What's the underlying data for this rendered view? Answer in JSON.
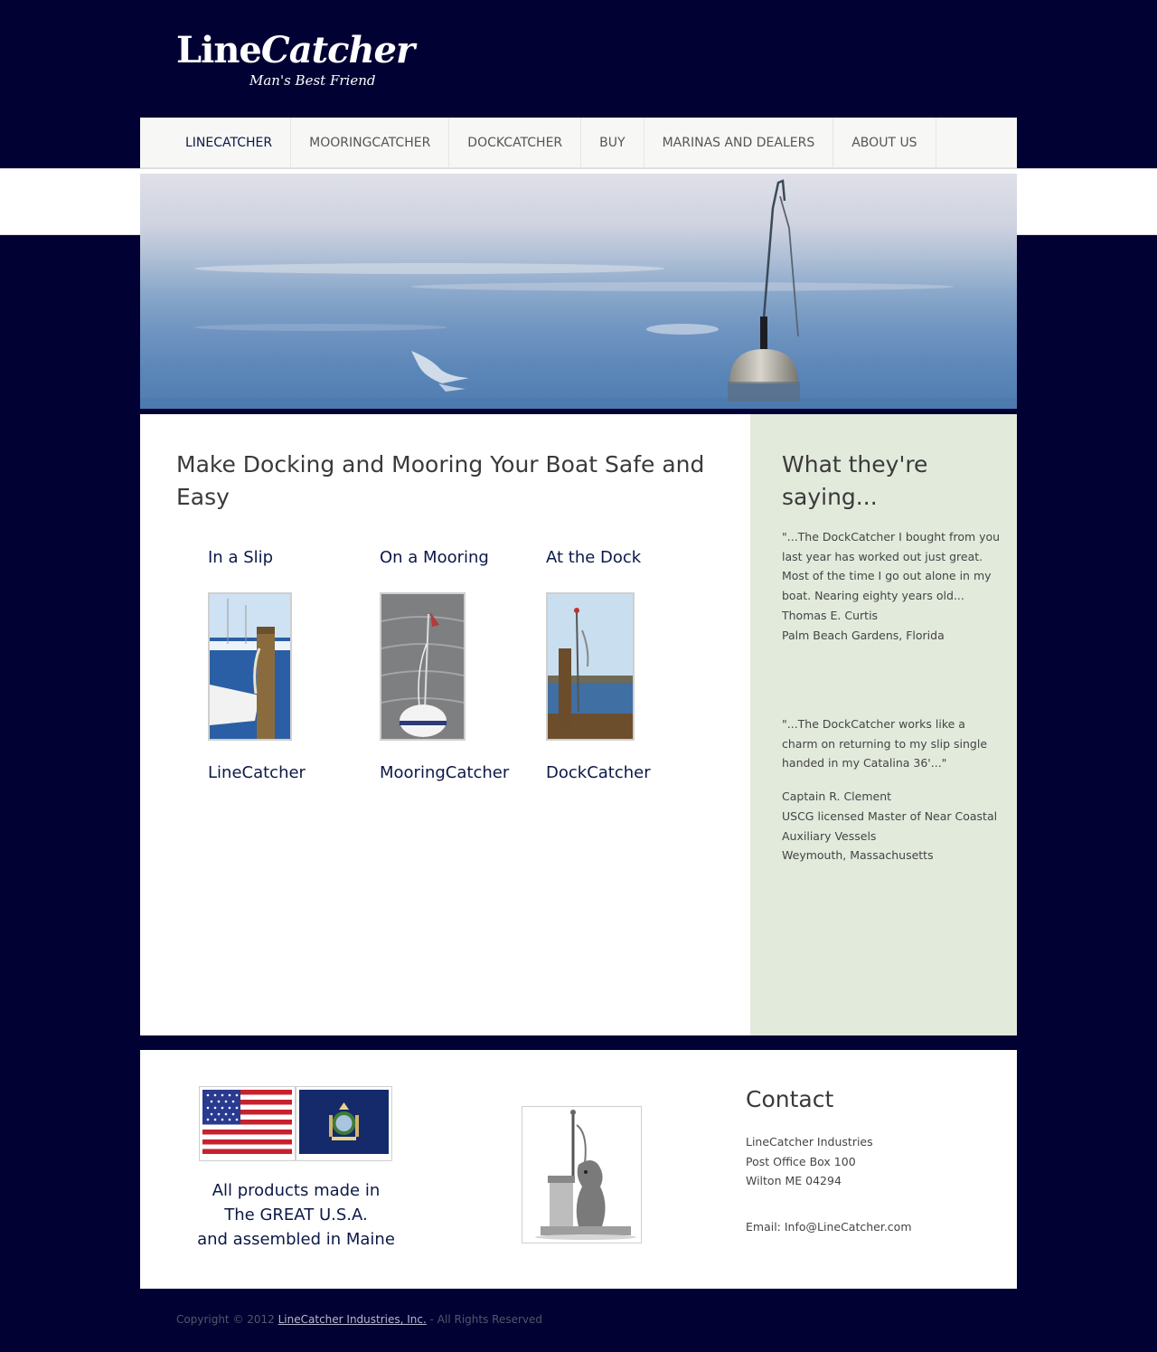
{
  "header": {
    "logo_line": "Line",
    "logo_catcher": "Catcher",
    "tagline": "Man's Best Friend"
  },
  "nav": {
    "items": [
      "LINECATCHER",
      "MOORINGCATCHER",
      "DOCKCATCHER",
      "BUY",
      "MARINAS AND DEALERS",
      "ABOUT US"
    ],
    "active": "LINECATCHER"
  },
  "main": {
    "heading": "Make Docking and Mooring Your Boat Safe and Easy",
    "columns": [
      {
        "label": "In a Slip",
        "product": "LineCatcher"
      },
      {
        "label": "On a Mooring",
        "product": "MooringCatcher"
      },
      {
        "label": "At the Dock",
        "product": "DockCatcher"
      }
    ]
  },
  "sidebar": {
    "heading_line1": "What they're",
    "heading_line2": "saying...",
    "testimonial1": {
      "quote": "\"...The DockCatcher I bought from you last year has worked out just great. Most of the time I go out alone in my boat. Nearing eighty years old...",
      "name": "Thomas E. Curtis",
      "location": "Palm Beach Gardens, Florida"
    },
    "testimonial2": {
      "quote": "\"...The DockCatcher works like a charm on returning to my slip single handed in my Catalina 36'...\"",
      "name": "Captain R. Clement",
      "title": "USCG licensed Master of Near Coastal Auxiliary Vessels",
      "location": "Weymouth, Massachusetts"
    }
  },
  "footer": {
    "made_in_1": "All products made in",
    "made_in_2": "The GREAT U.S.A.",
    "made_in_3": "and assembled in Maine",
    "contact_heading": "Contact",
    "contact_name": "LineCatcher Industries",
    "contact_po": "Post Office Box 100",
    "contact_city": "Wilton ME 04294",
    "contact_email": "Email: Info@LineCatcher.com"
  },
  "copyright": {
    "prefix": "Copyright © 2012 ",
    "link": "LineCatcher Industries, Inc.",
    "suffix": " - All Rights Reserved"
  },
  "colors": {
    "background": "#010133",
    "sidebar": "#e2eadc",
    "nav": "#f7f8f5",
    "accent": "#0c1848"
  }
}
